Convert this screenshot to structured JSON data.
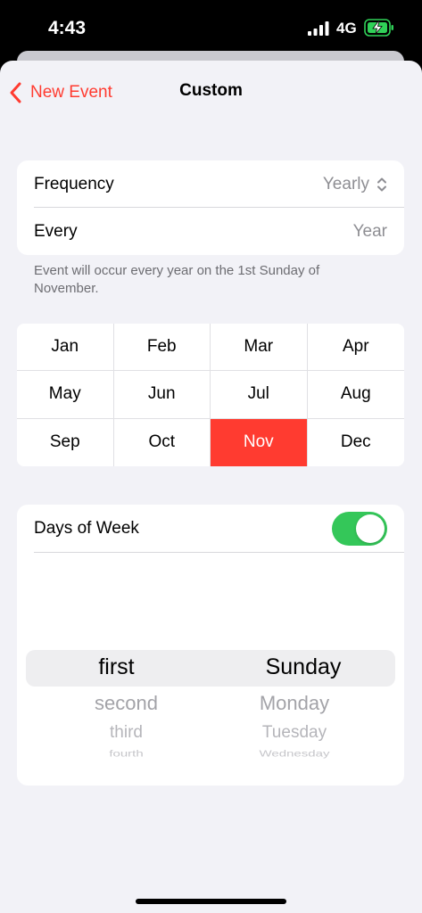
{
  "status_bar": {
    "time": "4:43",
    "network": "4G"
  },
  "nav": {
    "back_label": "New Event",
    "title": "Custom"
  },
  "frequency": {
    "label": "Frequency",
    "value": "Yearly"
  },
  "every": {
    "label": "Every",
    "value": "Year"
  },
  "footnote": "Event will occur every year on the 1st Sunday of November.",
  "months": [
    "Jan",
    "Feb",
    "Mar",
    "Apr",
    "May",
    "Jun",
    "Jul",
    "Aug",
    "Sep",
    "Oct",
    "Nov",
    "Dec"
  ],
  "selected_month": "Nov",
  "days_of_week": {
    "label": "Days of Week",
    "enabled": true
  },
  "picker": {
    "ordinals": [
      "first",
      "second",
      "third",
      "fourth"
    ],
    "days": [
      "Sunday",
      "Monday",
      "Tuesday",
      "Wednesday"
    ]
  },
  "colors": {
    "accent": "#ff3b30",
    "toggle_on": "#34c759",
    "battery": "#30d158"
  }
}
